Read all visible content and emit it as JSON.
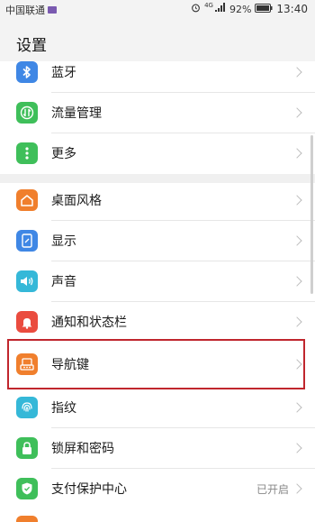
{
  "status_bar": {
    "carrier": "中国联通",
    "battery": "92%",
    "time": "13:40",
    "network": "4G"
  },
  "header": {
    "title": "设置"
  },
  "settings": [
    {
      "label": "蓝牙",
      "icon": "bluetooth-icon",
      "color": "#3f87e5"
    },
    {
      "label": "流量管理",
      "icon": "data-usage-icon",
      "color": "#3fbf5a"
    },
    {
      "label": "更多",
      "icon": "more-icon",
      "color": "#3fbf5a"
    },
    {
      "label": "桌面风格",
      "icon": "home-style-icon",
      "color": "#f07f2d"
    },
    {
      "label": "显示",
      "icon": "display-icon",
      "color": "#3f87e5"
    },
    {
      "label": "声音",
      "icon": "sound-icon",
      "color": "#35b8d8"
    },
    {
      "label": "通知和状态栏",
      "icon": "notification-icon",
      "color": "#ea4c3f"
    },
    {
      "label": "导航键",
      "icon": "navigation-key-icon",
      "color": "#f07f2d",
      "highlighted": true
    },
    {
      "label": "指纹",
      "icon": "fingerprint-icon",
      "color": "#35b8d8"
    },
    {
      "label": "锁屏和密码",
      "icon": "lock-icon",
      "color": "#3fbf5a"
    },
    {
      "label": "支付保护中心",
      "icon": "payment-protection-icon",
      "color": "#3fbf5a",
      "status": "已开启"
    }
  ],
  "colors": {
    "highlight_border": "#c0262d"
  }
}
